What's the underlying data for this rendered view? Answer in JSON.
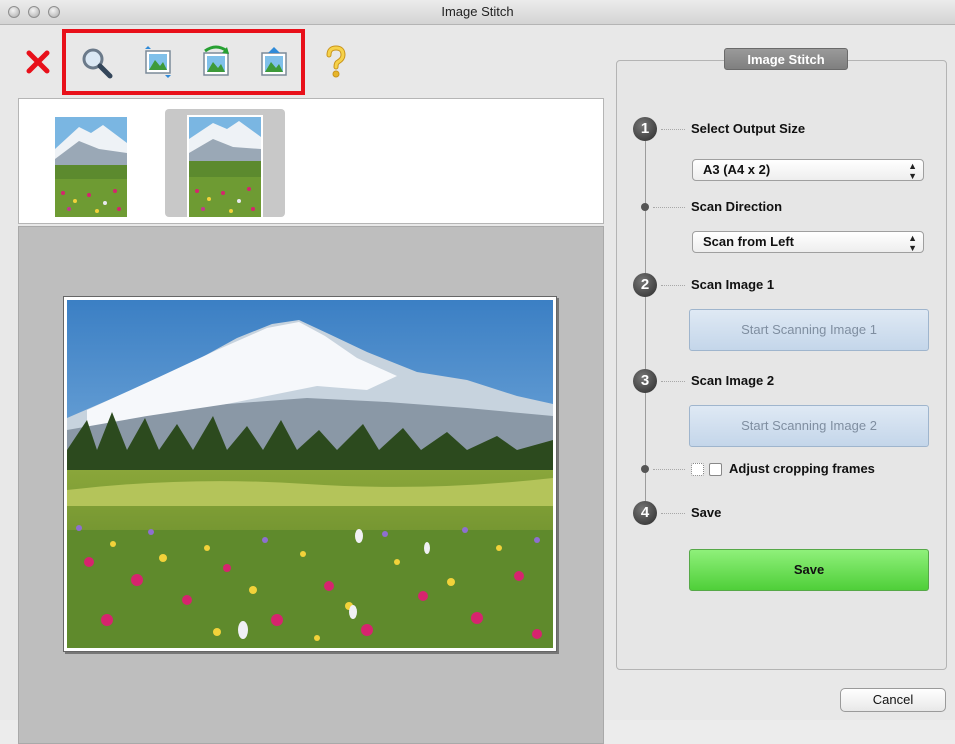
{
  "window": {
    "title": "Image Stitch"
  },
  "toolbar": {
    "items": [
      {
        "name": "close-icon",
        "color": "#e8101a"
      },
      {
        "name": "magnify-icon"
      },
      {
        "name": "swap-images-icon"
      },
      {
        "name": "rotate-image-icon"
      },
      {
        "name": "flip-image-icon"
      },
      {
        "name": "help-icon",
        "color": "#f2c21a"
      }
    ],
    "highlight_color": "#e8101a"
  },
  "thumbnails": {
    "count": 2,
    "selected_index": 1
  },
  "panel": {
    "title": "Image Stitch",
    "steps": [
      {
        "number": "1",
        "label": "Select Output Size"
      },
      {
        "number": "2",
        "label": "Scan Image 1"
      },
      {
        "number": "3",
        "label": "Scan Image 2"
      },
      {
        "number": "4",
        "label": "Save"
      }
    ],
    "output_size": {
      "value": "A3 (A4 x 2)"
    },
    "scan_direction": {
      "label": "Scan Direction",
      "value": "Scan from Left"
    },
    "scan_image_1_button": "Start Scanning Image 1",
    "scan_image_2_button": "Start Scanning Image 2",
    "adjust_cropping": {
      "label": "Adjust cropping frames",
      "checked": false
    },
    "save_button": "Save",
    "save_color": "#4fcf39"
  },
  "footer": {
    "cancel_button": "Cancel"
  }
}
